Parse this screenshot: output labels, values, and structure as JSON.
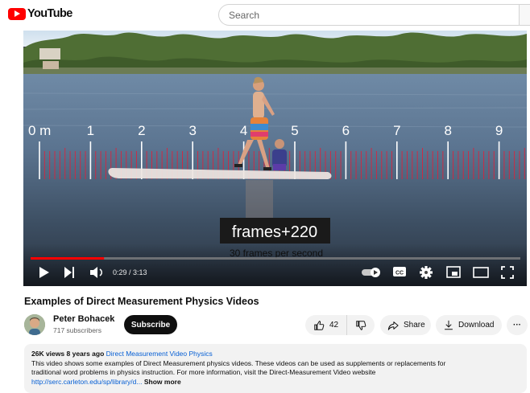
{
  "header": {
    "logo_text": "YouTube",
    "search_placeholder": "Search"
  },
  "player": {
    "caption_main": "frames+220",
    "caption_sub": "30 frames per second",
    "time": "0:29 / 3:13",
    "progress": 0.15,
    "ruler_labels": [
      "0 m",
      "1",
      "2",
      "3",
      "4",
      "5",
      "6",
      "7",
      "8",
      "9"
    ]
  },
  "video": {
    "title": "Examples of Direct Measurement Physics Videos",
    "channel_name": "Peter Bohacek",
    "subscribers": "717 subscribers",
    "subscribe_label": "Subscribe",
    "like_count": "42",
    "share_label": "Share",
    "download_label": "Download",
    "more_label": "···"
  },
  "description": {
    "views": "26K views",
    "age": "8 years ago",
    "tag": "Direct Measurement Video Physics",
    "line1": "This video shows some examples of Direct Measurement physics videos. These videos can be used as supplements or replacements for",
    "line2": "traditional word problems in physics instruction. For more information, visit the Direct-Measurement Video website",
    "link": "http://serc.carleton.edu/sp/library/d...",
    "show_more": "Show more"
  },
  "colors": {
    "brand_red": "#ff0000",
    "progress_red": "#ff0000",
    "link_blue": "#065fd4",
    "ruler_red": "#e0203a"
  }
}
